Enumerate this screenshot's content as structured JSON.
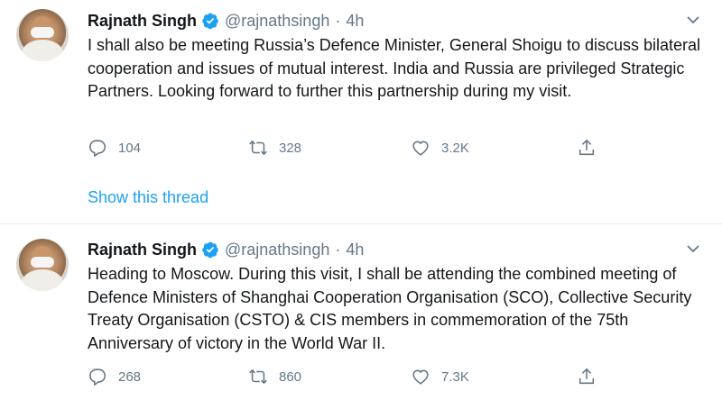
{
  "tweets": [
    {
      "name": "Rajnath Singh",
      "handle": "@rajnathsingh",
      "separator": "·",
      "time": "4h",
      "text": "I shall also be meeting Russia’s Defence Minister, General Shoigu to discuss bilateral cooperation and issues of mutual interest. India and Russia are privileged Strategic Partners. Looking forward to further this partnership during my visit.",
      "replies": "104",
      "retweets": "328",
      "likes": "3.2K",
      "show_thread": "Show this thread"
    },
    {
      "name": "Rajnath Singh",
      "handle": "@rajnathsingh",
      "separator": "·",
      "time": "4h",
      "text": "Heading to Moscow. During this visit, I shall be attending the combined meeting of Defence Ministers of Shanghai Cooperation Organisation (SCO), Collective Security Treaty Organisation (CSTO) & CIS members in commemoration of the 75th Anniversary of victory in the World War II.",
      "replies": "268",
      "retweets": "860",
      "likes": "7.3K"
    }
  ],
  "colors": {
    "link_blue": "#1da1f2",
    "muted_gray": "#657786",
    "text_dark": "#14171a",
    "divider": "#e6ecf0"
  },
  "icons": {
    "verified": "verified-badge-icon",
    "caret": "chevron-down-icon",
    "reply": "reply-icon",
    "retweet": "retweet-icon",
    "like": "heart-icon",
    "share": "share-icon"
  }
}
